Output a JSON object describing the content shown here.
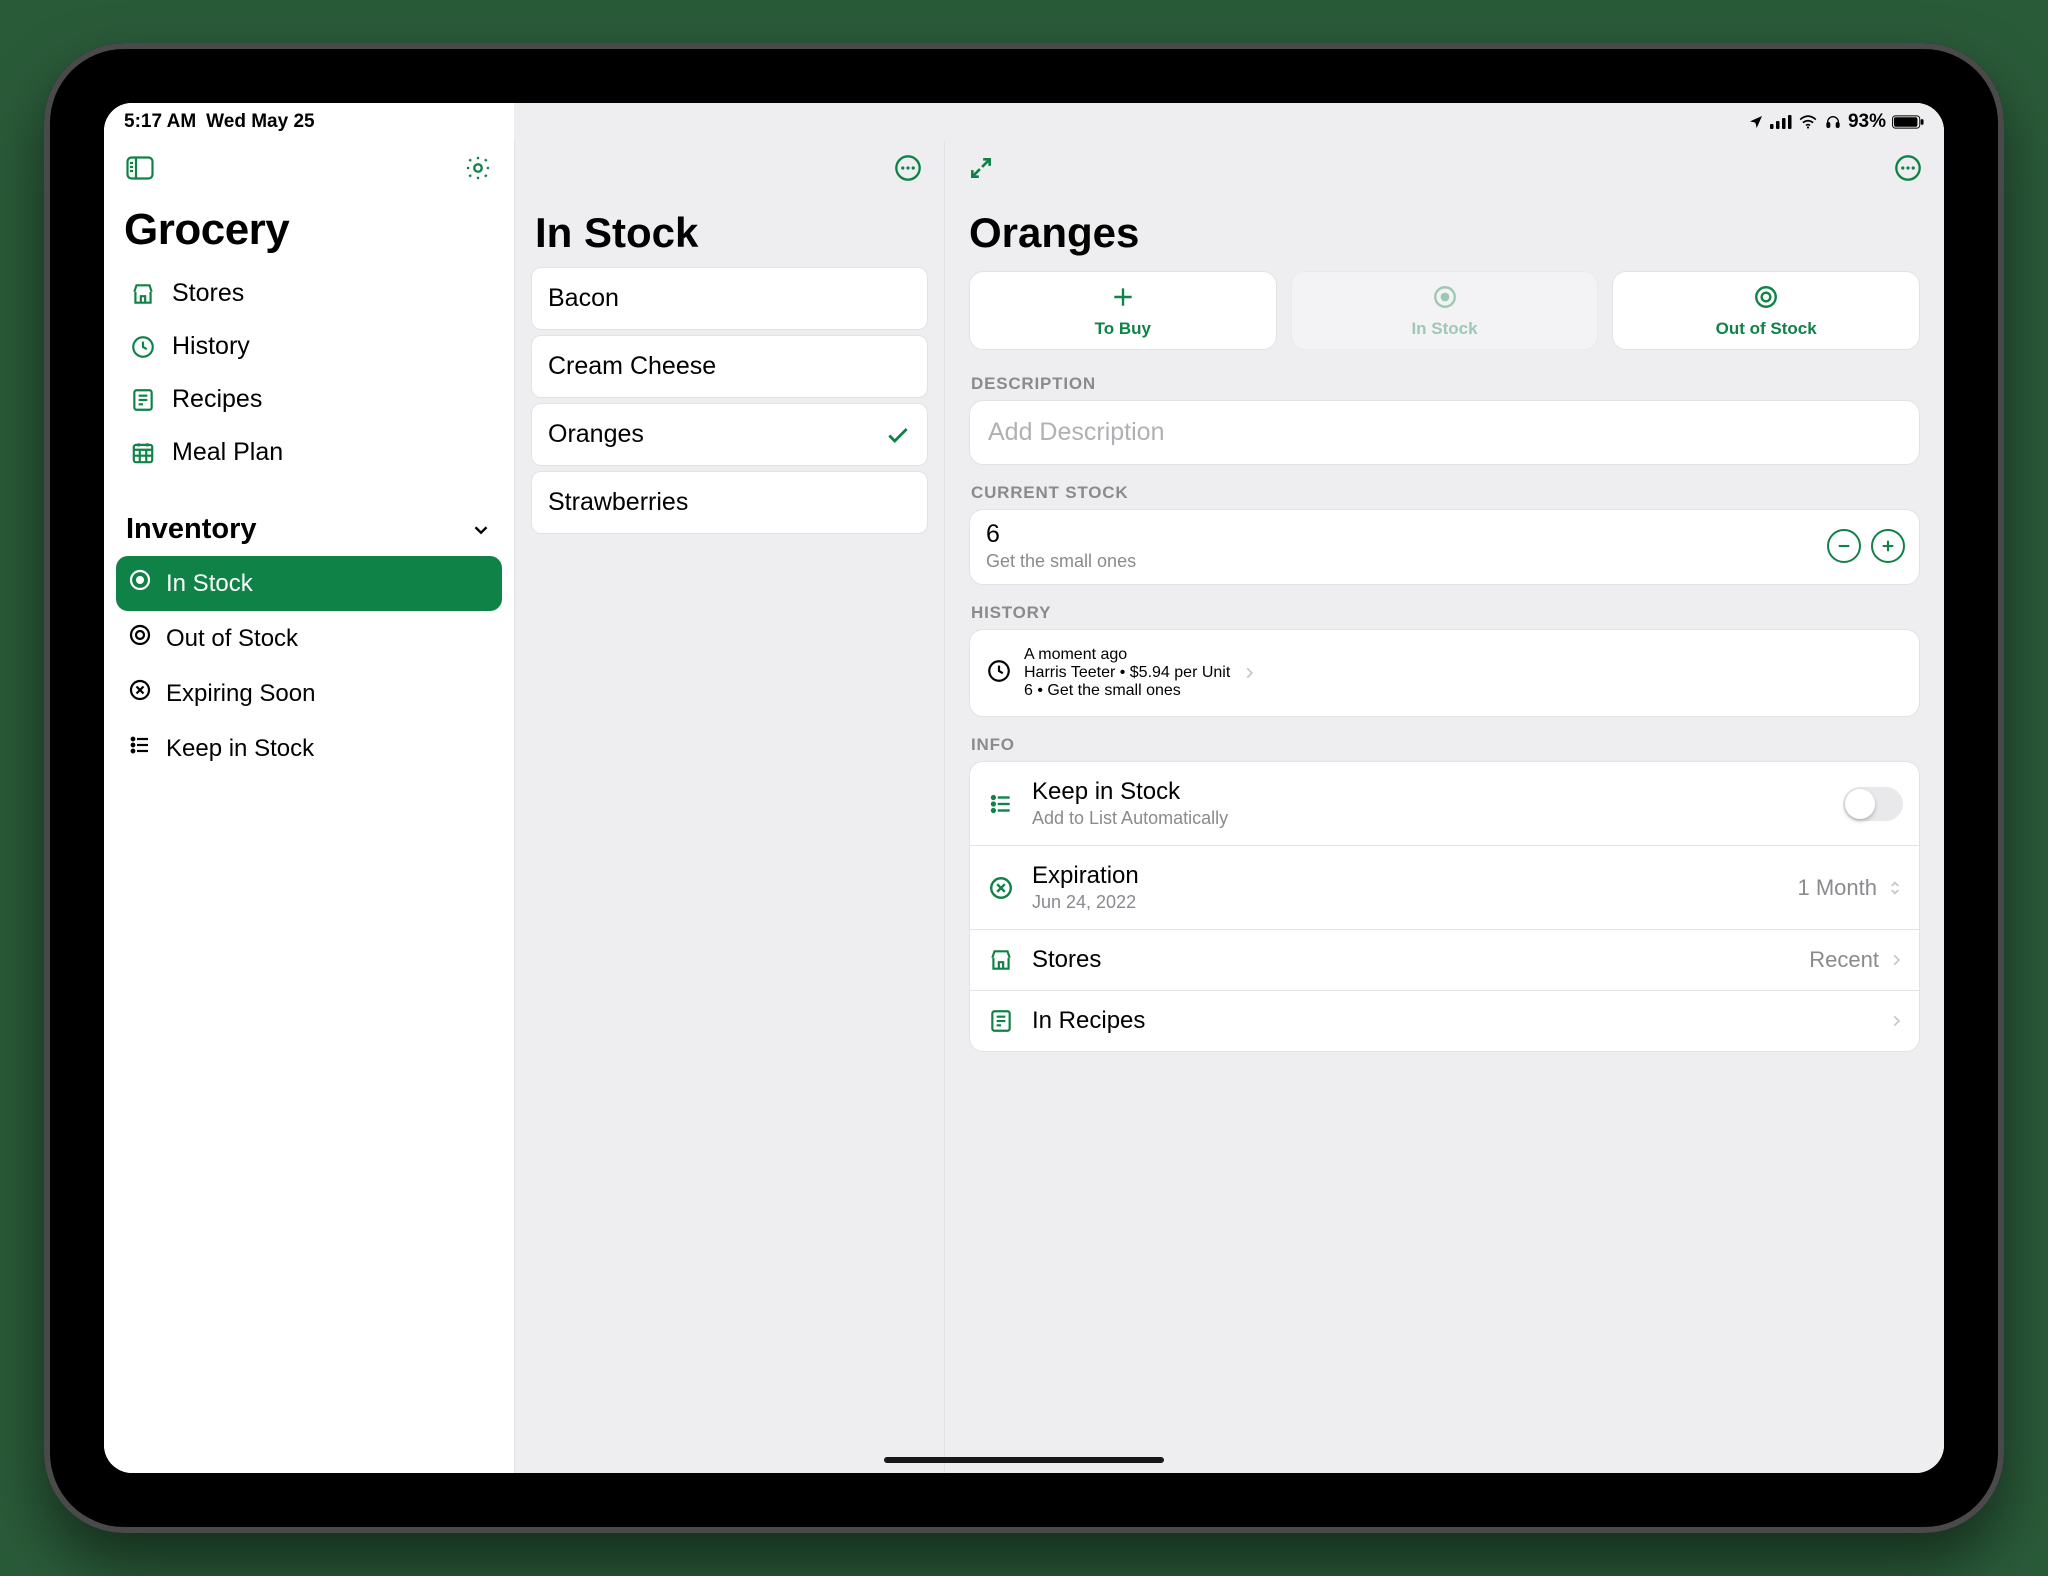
{
  "status": {
    "time": "5:17 AM",
    "date": "Wed May 25",
    "battery": "93%"
  },
  "sidebar": {
    "title": "Grocery",
    "items": [
      {
        "label": "Stores"
      },
      {
        "label": "History"
      },
      {
        "label": "Recipes"
      },
      {
        "label": "Meal Plan"
      }
    ],
    "inventory_header": "Inventory",
    "inventory": [
      {
        "label": "In Stock",
        "selected": true
      },
      {
        "label": "Out of Stock"
      },
      {
        "label": "Expiring Soon"
      },
      {
        "label": "Keep in Stock"
      }
    ]
  },
  "mid": {
    "title": "In Stock",
    "items": [
      "Bacon",
      "Cream Cheese",
      "Oranges",
      "Strawberries"
    ],
    "selected_index": 2
  },
  "detail": {
    "title": "Oranges",
    "segments": {
      "to_buy": "To Buy",
      "in_stock": "In Stock",
      "out_of_stock": "Out of Stock"
    },
    "description": {
      "label": "Description",
      "placeholder": "Add Description",
      "value": ""
    },
    "current_stock": {
      "label": "Current Stock",
      "value": "6",
      "note": "Get the small ones"
    },
    "history": {
      "label": "History",
      "time": "A moment ago",
      "line1": "Harris Teeter • $5.94 per Unit",
      "line2": "6 • Get the small ones"
    },
    "info": {
      "label": "Info",
      "keep_in_stock": {
        "title": "Keep in Stock",
        "sub": "Add to List Automatically",
        "on": false
      },
      "expiration": {
        "title": "Expiration",
        "sub": "Jun 24, 2022",
        "value": "1 Month"
      },
      "stores": {
        "title": "Stores",
        "value": "Recent"
      },
      "in_recipes": {
        "title": "In Recipes"
      }
    }
  }
}
